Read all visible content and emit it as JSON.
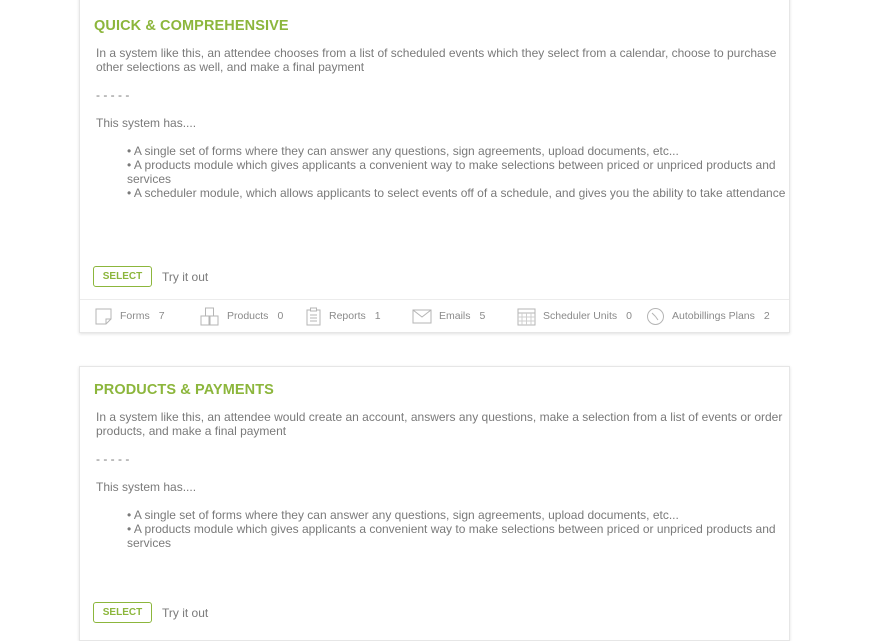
{
  "cards": [
    {
      "title": "QUICK & COMPREHENSIVE",
      "description": "In a system like this, an attendee chooses from a list of scheduled events which they select from a calendar, choose to purchase other selections as well, and make a final payment",
      "separator": "- - - - -",
      "has_label": "This system has....",
      "features": [
        "• A single set of forms where they can answer any questions, sign agreements, upload documents, etc...",
        "• A products module which gives applicants a convenient way to make selections between priced or unpriced products and services",
        "• A scheduler module, which allows applicants to select events off of a schedule, and gives you the ability to take attendance"
      ],
      "select_label": "SELECT",
      "try_label": "Try it out",
      "stats": [
        {
          "label": "Forms",
          "count": "7",
          "icon": "form-icon"
        },
        {
          "label": "Products",
          "count": "0",
          "icon": "products-icon"
        },
        {
          "label": "Reports",
          "count": "1",
          "icon": "clipboard-icon"
        },
        {
          "label": "Emails",
          "count": "5",
          "icon": "envelope-icon"
        },
        {
          "label": "Scheduler Units",
          "count": "0",
          "icon": "calendar-icon"
        },
        {
          "label": "Autobillings Plans",
          "count": "2",
          "icon": "clock-icon"
        }
      ]
    },
    {
      "title": "PRODUCTS & PAYMENTS",
      "description": "In a system like this, an attendee would create an account, answers any questions, make a selection from a list of events or order products, and make a final payment",
      "separator": "- - - - -",
      "has_label": "This system has....",
      "features": [
        "• A single set of forms where they can answer any questions, sign agreements, upload documents, etc...",
        "• A products module which gives applicants a convenient way to make selections between priced or unpriced products and services"
      ],
      "select_label": "SELECT",
      "try_label": "Try it out"
    }
  ],
  "colors": {
    "accent": "#8cb63c",
    "text": "#7a7a7a",
    "border": "#e6e6e6"
  }
}
